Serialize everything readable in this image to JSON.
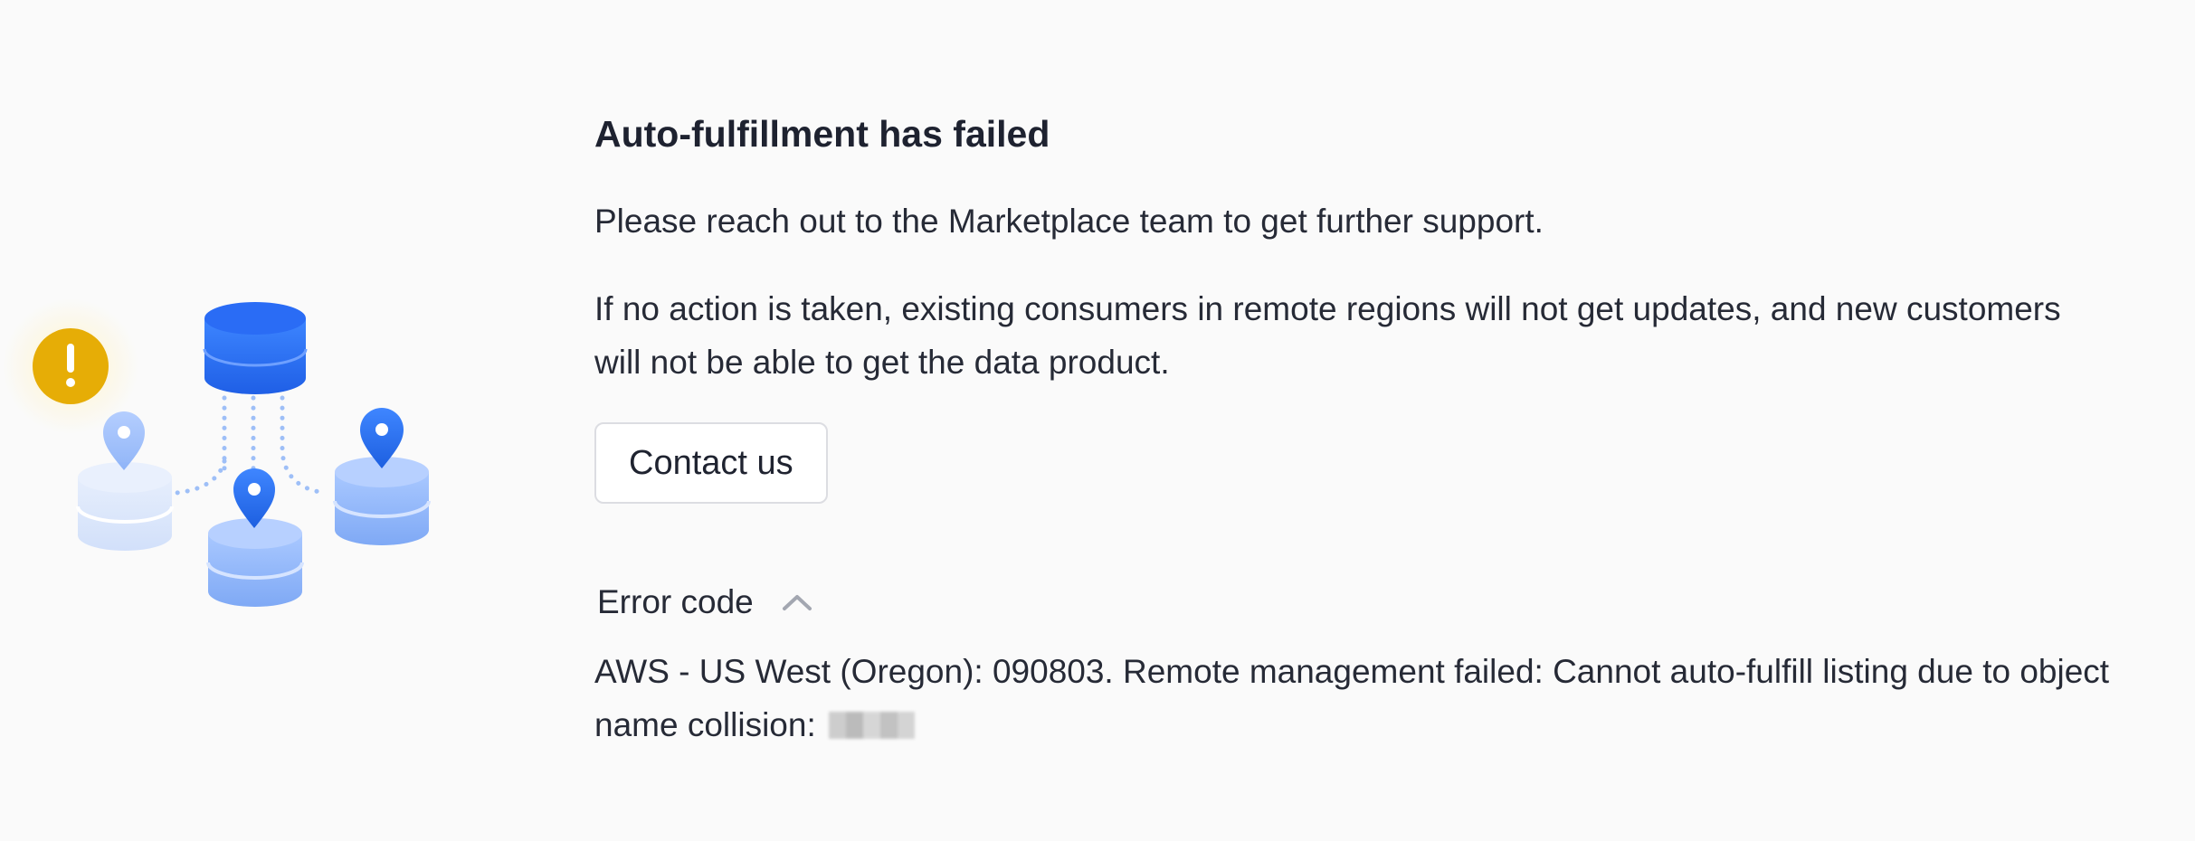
{
  "illustration": {
    "alert_symbol": "!",
    "alert_color": "#e8b008",
    "accent_blue": "#2d6ef5"
  },
  "main": {
    "title": "Auto-fulfillment has failed",
    "message_1": "Please reach out to the Marketplace team to get further support.",
    "message_2": "If no action is taken, existing consumers in remote regions will not get updates, and new customers will not be able to get the data product.",
    "contact_button": "Contact us"
  },
  "error": {
    "label": "Error code",
    "expanded": true,
    "toggle_icon": "chevron-up-icon",
    "text": "AWS - US West (Oregon): 090803. Remote management failed: Cannot auto-fulfill listing due to object name collision:"
  }
}
